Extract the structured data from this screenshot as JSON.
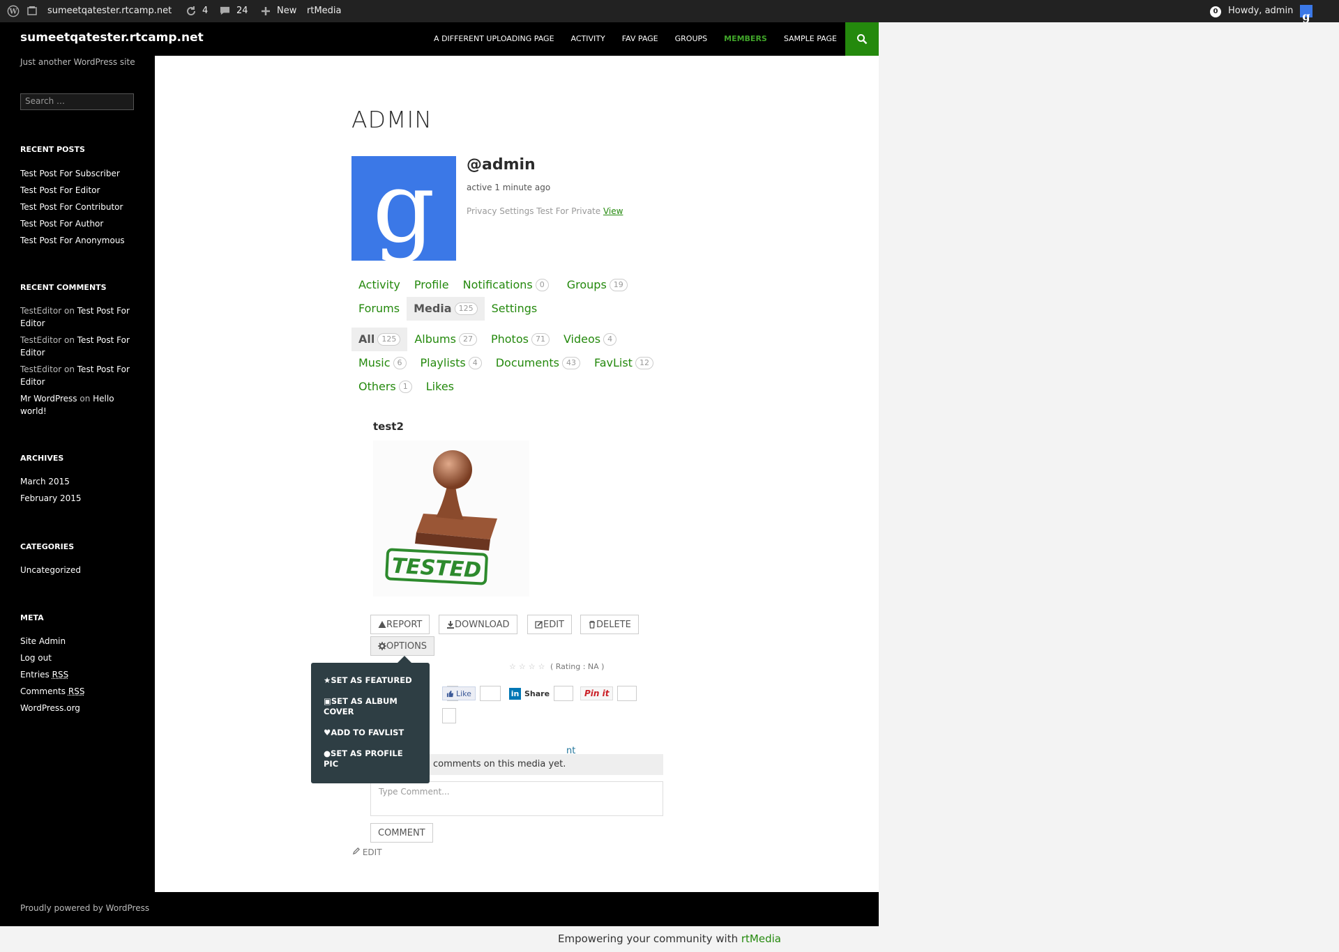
{
  "adminbar": {
    "site": "sumeetqatester.rtcamp.net",
    "updates": "4",
    "comments": "24",
    "new": "New",
    "rtmedia": "rtMedia",
    "notif_count": "0",
    "howdy": "Howdy, admin"
  },
  "masthead": {
    "title": "sumeetqatester.rtcamp.net",
    "nav": [
      "A DIFFERENT UPLOADING PAGE",
      "ACTIVITY",
      "FAV PAGE",
      "GROUPS",
      "MEMBERS",
      "SAMPLE PAGE"
    ]
  },
  "sidebar": {
    "description": "Just another WordPress site",
    "search_placeholder": "Search …",
    "recent_posts_title": "RECENT POSTS",
    "recent_posts": [
      "Test Post For Subscriber",
      "Test Post For Editor",
      "Test Post For Contributor",
      "Test Post For Author",
      "Test Post For Anonymous"
    ],
    "recent_comments_title": "RECENT COMMENTS",
    "recent_comments": [
      {
        "author": "TestEditor",
        "on": "on",
        "post": "Test Post For Editor"
      },
      {
        "author": "TestEditor",
        "on": "on",
        "post": "Test Post For Editor"
      },
      {
        "author": "TestEditor",
        "on": "on",
        "post": "Test Post For Editor"
      },
      {
        "author": "Mr WordPress",
        "on": "on",
        "post": "Hello world!"
      }
    ],
    "archives_title": "ARCHIVES",
    "archives": [
      "March 2015",
      "February 2015"
    ],
    "categories_title": "CATEGORIES",
    "categories": [
      "Uncategorized"
    ],
    "meta_title": "META",
    "meta": [
      {
        "text": "Site Admin",
        "suffix": ""
      },
      {
        "text": "Log out",
        "suffix": ""
      },
      {
        "text": "Entries ",
        "suffix": "RSS"
      },
      {
        "text": "Comments ",
        "suffix": "RSS"
      },
      {
        "text": "WordPress.org",
        "suffix": ""
      }
    ]
  },
  "profile": {
    "page_title": "ADMIN",
    "username": "@admin",
    "active": "active 1 minute ago",
    "privacy_text": "Privacy Settings Test For Private ",
    "privacy_link": "View"
  },
  "profile_nav": {
    "row1": [
      {
        "label": "Activity",
        "count": ""
      },
      {
        "label": "Profile",
        "count": ""
      },
      {
        "label": "Notifications",
        "count": "0"
      },
      {
        "label": "Groups",
        "count": "19"
      }
    ],
    "row2": [
      {
        "label": "Forums",
        "count": ""
      },
      {
        "label": "Media",
        "count": "125"
      },
      {
        "label": "Settings",
        "count": ""
      }
    ]
  },
  "media_nav": {
    "row1": [
      {
        "label": "All",
        "count": "125"
      },
      {
        "label": "Albums",
        "count": "27"
      },
      {
        "label": "Photos",
        "count": "71"
      },
      {
        "label": "Videos",
        "count": "4"
      }
    ],
    "row2": [
      {
        "label": "Music",
        "count": "6"
      },
      {
        "label": "Playlists",
        "count": "4"
      },
      {
        "label": "Documents",
        "count": "43"
      },
      {
        "label": "FavList",
        "count": "12"
      }
    ],
    "row3": [
      {
        "label": "Others",
        "count": "1"
      },
      {
        "label": "Likes",
        "count": ""
      }
    ]
  },
  "media": {
    "title": "test2",
    "stamp_text": "TESTED",
    "buttons": {
      "report": "REPORT",
      "download": "DOWNLOAD",
      "edit": "EDIT",
      "delete": "DELETE",
      "options": "OPTIONS"
    },
    "rating": "( Rating : NA )",
    "share": {
      "fb_like": "Like",
      "linkedin": "Share",
      "pinterest": "Pin it"
    },
    "add_comment_fragment": "nt",
    "no_comments": "comments on this media yet.",
    "comment_placeholder": "Type Comment...",
    "comment_button": "COMMENT",
    "edit_link": "EDIT"
  },
  "options_menu": [
    "SET AS FEATURED",
    "SET AS ALBUM COVER",
    "ADD TO FAVLIST",
    "SET AS PROFILE PIC"
  ],
  "footer": {
    "powered": "Proudly powered by WordPress",
    "empower_text": "Empowering your community with ",
    "empower_link": "rtMedia"
  },
  "colors": {
    "accent": "#24890d",
    "masthead": "#000000",
    "adminbar": "#222222",
    "popover": "#2e3e44"
  }
}
